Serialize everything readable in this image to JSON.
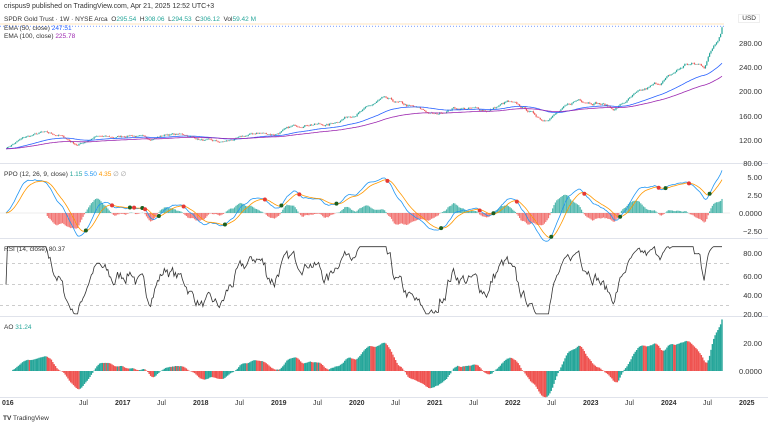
{
  "header": {
    "published": "crispus9 published on TradingView.com, Apr 21, 2025 12:52 UTC+3"
  },
  "symbol": {
    "name": "SPDR Gold Trust · 1W · NYSE Arca",
    "o_label": "O",
    "o": "295.54",
    "h_label": "H",
    "h": "308.06",
    "l_label": "L",
    "l": "294.53",
    "c_label": "C",
    "c": "306.12",
    "vol_label": "Vol",
    "vol": "59.42 M"
  },
  "indicators": {
    "ema50": {
      "label": "EMA (50, close)",
      "value": "247.51",
      "color": "#2962ff"
    },
    "ema100": {
      "label": "EMA (100, close)",
      "value": "225.78",
      "color": "#9c27b0"
    },
    "ppo": {
      "label": "PPO (12, 26, 9, close)",
      "hist": "1.15",
      "ppo": "5.50",
      "signal": "4.35",
      "extra": "∅ ∅"
    },
    "rsi": {
      "label": "RSI (14, close)",
      "value": "80.37"
    },
    "ao": {
      "label": "AO",
      "value": "31.24"
    }
  },
  "axes": {
    "currency": "USD",
    "price_ticks": [
      "280.00",
      "240.00",
      "200.00",
      "160.00",
      "120.00",
      "80.00"
    ],
    "ppo_ticks": [
      "5.00",
      "2.50",
      "0.0000",
      "−2.50"
    ],
    "rsi_ticks": [
      "80.00",
      "60.00",
      "40.00",
      "20.00"
    ],
    "ao_ticks": [
      "20.00",
      "0.0000"
    ],
    "time_labels": [
      {
        "t": "016",
        "b": true
      },
      {
        "t": "Jul"
      },
      {
        "t": "2017",
        "b": true
      },
      {
        "t": "Jul"
      },
      {
        "t": "2018",
        "b": true
      },
      {
        "t": "Jul"
      },
      {
        "t": "2019",
        "b": true
      },
      {
        "t": "Jul"
      },
      {
        "t": "2020",
        "b": true
      },
      {
        "t": "Jul"
      },
      {
        "t": "2021",
        "b": true
      },
      {
        "t": "Jul"
      },
      {
        "t": "2022",
        "b": true
      },
      {
        "t": "Jul"
      },
      {
        "t": "2023",
        "b": true
      },
      {
        "t": "Jul"
      },
      {
        "t": "2024",
        "b": true
      },
      {
        "t": "Jul"
      },
      {
        "t": "2025",
        "b": true
      }
    ]
  },
  "footer": {
    "brand": "TradingView"
  },
  "colors": {
    "up": "#26a69a",
    "down": "#ef5350",
    "ppo": "#2196f3",
    "signal": "#ff9800",
    "rsi": "#333333"
  },
  "chart_data": {
    "type": "candlestick",
    "title": "SPDR Gold Trust · 1W · NYSE Arca",
    "ylabel": "USD",
    "ylim": [
      80,
      310
    ],
    "quarterly_close_from_2016Q1": [
      105,
      122,
      130,
      126,
      110,
      124,
      122,
      127,
      120,
      128,
      127,
      118,
      114,
      121,
      130,
      128,
      140,
      146,
      143,
      157,
      168,
      186,
      178,
      170,
      160,
      172,
      170,
      168,
      181,
      170,
      152,
      167,
      186,
      182,
      170,
      190,
      205,
      222,
      245,
      242,
      306
    ]
  }
}
